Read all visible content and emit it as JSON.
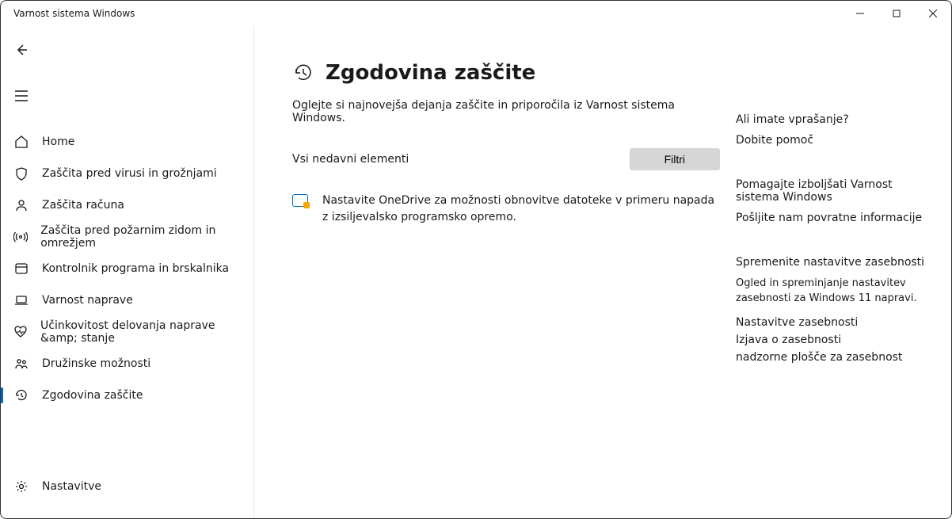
{
  "window": {
    "title": "Varnost sistema Windows"
  },
  "sidebar": {
    "items": [
      {
        "label": "Home"
      },
      {
        "label": "Zaščita pred virusi in grožnjami"
      },
      {
        "label": "Zaščita računa"
      },
      {
        "label": "Zaščita pred požarnim zidom in omrežjem"
      },
      {
        "label": "Kontrolnik programa in brskalnika"
      },
      {
        "label": "Varnost naprave"
      },
      {
        "label": "Učinkovitost delovanja naprave &amp; stanje"
      },
      {
        "label": "Družinske možnosti"
      },
      {
        "label": "Zgodovina zaščite"
      }
    ],
    "settings_label": "Nastavitve"
  },
  "page": {
    "title": "Zgodovina zaščite",
    "subtitle": "Oglejte si najnovejša dejanja zaščite in priporočila iz Varnost sistema Windows.",
    "section_label": "Vsi nedavni elementi",
    "filter_label": "Filtri",
    "card_text": "Nastavite OneDrive za možnosti obnovitve datoteke v primeru napada z izsiljevalsko programsko opremo."
  },
  "aside": {
    "question_heading": "Ali imate vprašanje?",
    "get_help": "Dobite pomoč",
    "improve_heading": "Pomagajte izboljšati Varnost sistema Windows",
    "feedback": "Pošljite nam povratne informacije",
    "privacy_change_heading": "Spremenite nastavitve zasebnosti",
    "privacy_change_text": "Ogled in spreminjanje nastavitev zasebnosti za Windows 11 napravi.",
    "privacy_settings": "Nastavitve zasebnosti",
    "privacy_statement": "Izjava o zasebnosti",
    "privacy_dashboard": "nadzorne plošče za zasebnost"
  }
}
